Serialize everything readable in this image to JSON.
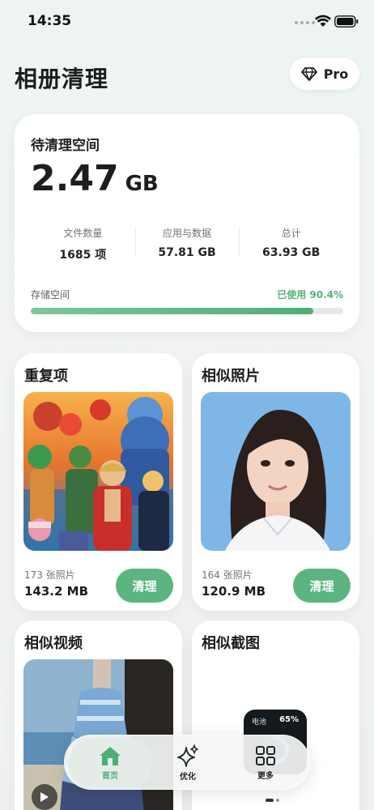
{
  "status_bar": {
    "time": "14:35"
  },
  "header": {
    "title": "相册清理",
    "pro_label": "Pro"
  },
  "summary": {
    "label": "待清理空间",
    "value": "2.47",
    "unit": "GB",
    "stats": [
      {
        "label": "文件数量",
        "value": "1685 项"
      },
      {
        "label": "应用与数据",
        "value": "57.81 GB"
      },
      {
        "label": "总计",
        "value": "63.93 GB"
      }
    ],
    "storage_label": "存储空间",
    "storage_used": "已使用 90.4%",
    "storage_fraction": 0.904
  },
  "categories": [
    {
      "title": "重复项",
      "count": "173 张照片",
      "size": "143.2 MB",
      "button": "清理"
    },
    {
      "title": "相似照片",
      "count": "164 张照片",
      "size": "120.9 MB",
      "button": "清理"
    },
    {
      "title": "相似视频"
    },
    {
      "title": "相似截图",
      "widget_label": "电池",
      "widget_value": "65%"
    }
  ],
  "tabs": [
    {
      "label": "首页",
      "icon": "house-icon"
    },
    {
      "label": "优化",
      "icon": "sparkle-icon"
    },
    {
      "label": "更多",
      "icon": "grid-icon"
    }
  ],
  "colors": {
    "accent": "#5cb581",
    "background": "#eef5f1"
  }
}
